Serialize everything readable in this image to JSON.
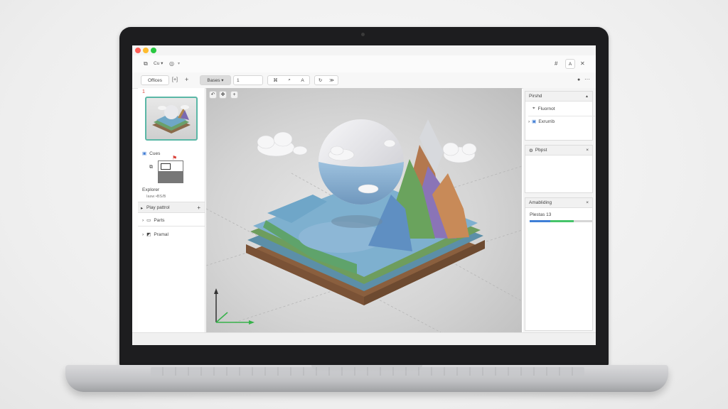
{
  "toolbar": {
    "edit_label": "Cu",
    "workspace_label": "Offices",
    "add_label": "+",
    "mode_dropdown": "Bases",
    "page_value": "1"
  },
  "left_panel": {
    "marker": "1",
    "assets_label": "Cues",
    "explorer_label": "Explorer",
    "explorer_sub": "Iasw •BS/B",
    "hierarchy_title": "Play pattrol",
    "hierarchy_add": "+",
    "items": [
      {
        "label": "Parts"
      },
      {
        "label": "Pramal"
      }
    ]
  },
  "right_panel": {
    "panel1_title": "Pirshd",
    "panel1_items": [
      {
        "label": "Fluornot"
      },
      {
        "label": "Exrurrib"
      }
    ],
    "panel2_title": "Pbpst",
    "panel3_title": "Amabliding",
    "progress_label": "Plestas 13",
    "progress": {
      "blue": 0.33,
      "green": 0.37,
      "gray": 0.3
    },
    "close_glyph": "×",
    "collapse_glyph": "▲"
  },
  "colors": {
    "accent_teal": "#5ab7a6",
    "progress_blue": "#3f7fd6",
    "progress_green": "#46c46a",
    "close_red": "#ff5f57",
    "minimize_yellow": "#febc2e",
    "maximize_green": "#28c840"
  }
}
